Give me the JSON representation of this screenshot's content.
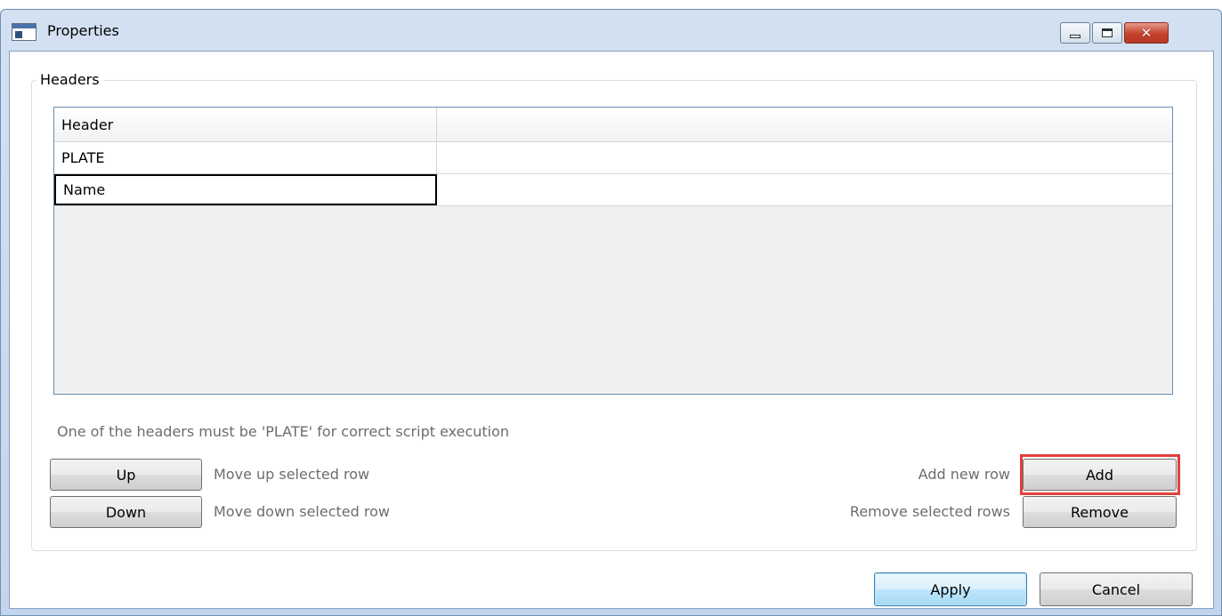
{
  "window": {
    "title": "Properties",
    "icon": "app-window-icon",
    "controls": [
      "minimize-icon",
      "maximize-icon",
      "close-icon"
    ],
    "close_glyph": "✕"
  },
  "headers_group": {
    "label": "Headers",
    "grid": {
      "columns": [
        "Header",
        ""
      ],
      "rows": [
        [
          "PLATE",
          ""
        ],
        [
          "Name",
          ""
        ]
      ]
    },
    "hint": "One of the headers must be 'PLATE' for correct script execution",
    "buttons": {
      "up": "Up",
      "down": "Down",
      "add": "Add",
      "remove": "Remove"
    },
    "descriptions": {
      "up": "Move up selected row",
      "down": "Move down selected row",
      "add": "Add new row",
      "remove": "Remove selected rows"
    }
  },
  "footer": {
    "apply": "Apply",
    "cancel": "Cancel"
  },
  "colors": {
    "titlebar": "#c9dbef",
    "close_button": "#c4412d",
    "highlight": "#e0403a",
    "grid_border": "#688caf",
    "hint_text": "#6d6d6d"
  }
}
